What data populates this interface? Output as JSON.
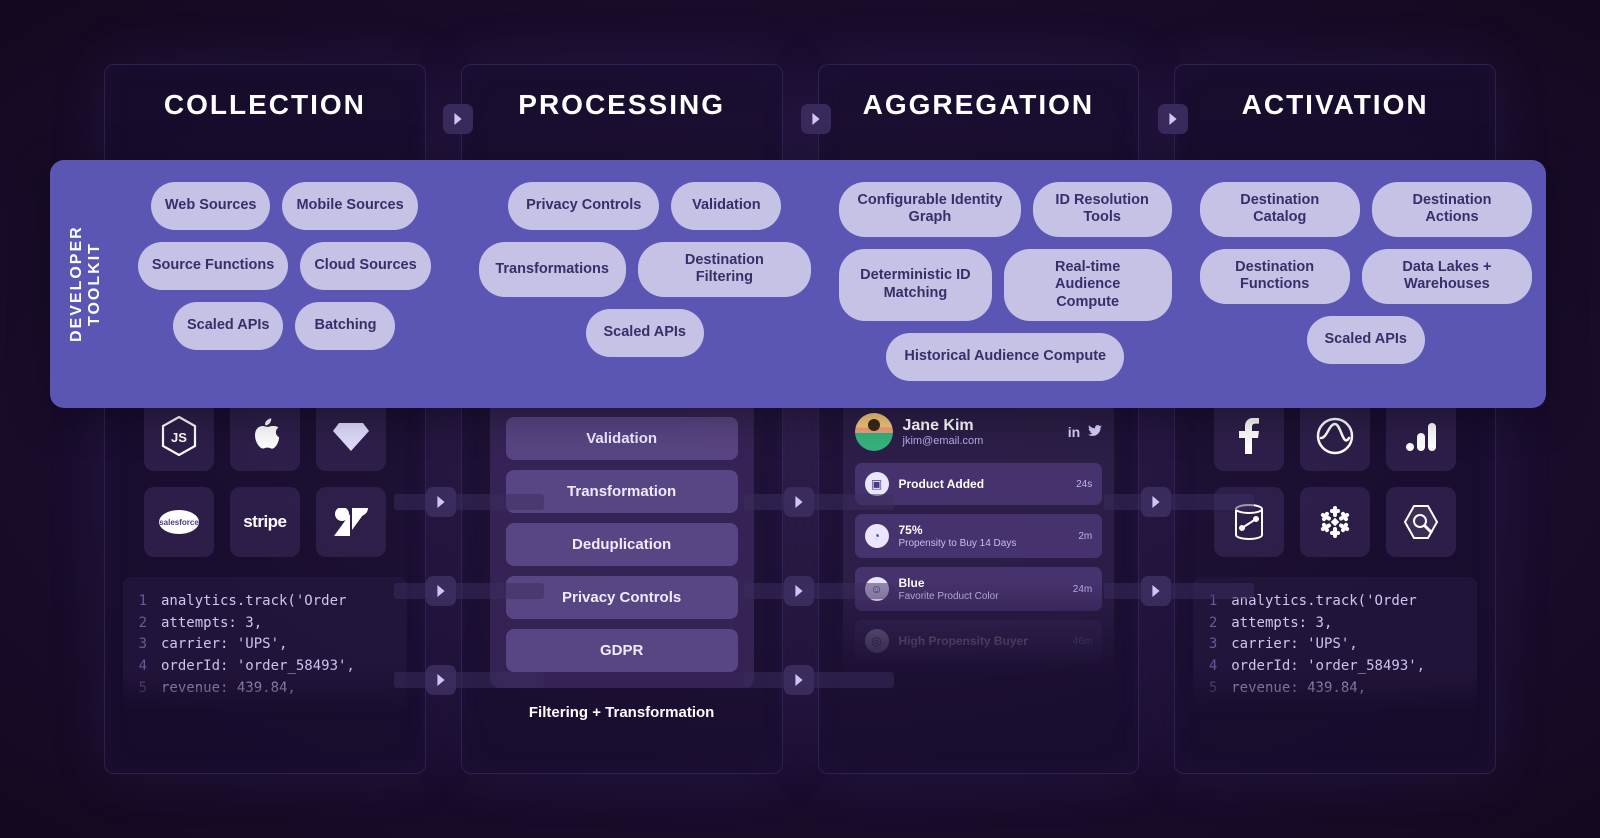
{
  "toolkit_label": "DEVELOPER TOOLKIT",
  "columns": [
    {
      "title": "COLLECTION"
    },
    {
      "title": "PROCESSING"
    },
    {
      "title": "AGGREGATION"
    },
    {
      "title": "ACTIVATION"
    }
  ],
  "toolkit": {
    "collection": [
      [
        "Web Sources",
        "Mobile Sources"
      ],
      [
        "Source Functions",
        "Cloud Sources"
      ],
      [
        "Scaled APIs",
        "Batching"
      ]
    ],
    "processing": [
      [
        "Privacy Controls",
        "Validation"
      ],
      [
        "Transformations",
        "Destination Filtering"
      ],
      [
        "Scaled APIs"
      ]
    ],
    "aggregation": [
      [
        "Configurable Identity Graph",
        "ID Resolution Tools"
      ],
      [
        "Deterministic ID Matching",
        "Real-time Audience Compute"
      ],
      [
        "Historical Audience Compute"
      ]
    ],
    "activation": [
      [
        "Destination Catalog",
        "Destination Actions"
      ],
      [
        "Destination Functions",
        "Data Lakes + Warehouses"
      ],
      [
        "Scaled APIs"
      ]
    ]
  },
  "collection_icons": [
    "nodejs",
    "apple",
    "diamond",
    "salesforce",
    "stripe",
    "zendesk"
  ],
  "activation_icons": [
    "facebook",
    "amplitude",
    "analytics",
    "database",
    "snowflake",
    "bigquery"
  ],
  "processing_items": [
    "Validation",
    "Transformation",
    "Deduplication",
    "Privacy Controls",
    "GDPR"
  ],
  "processing_caption": "Filtering + Transformation",
  "profile": {
    "name": "Jane Kim",
    "email": "jkim@email.com",
    "events": [
      {
        "icon": "briefcase",
        "title": "Product Added",
        "sub": "",
        "time": "24s"
      },
      {
        "icon": "gauge",
        "title": "75%",
        "sub": "Propensity to Buy 14 Days",
        "time": "2m"
      },
      {
        "icon": "user",
        "title": "Blue",
        "sub": "Favorite Product Color",
        "time": "24m"
      },
      {
        "icon": "target",
        "title": "High Propensity Buyer",
        "sub": "",
        "time": "46m",
        "faded": true
      }
    ]
  },
  "code": [
    "analytics.track('Order",
    "attempts: 3,",
    "carrier: 'UPS',",
    "orderId: 'order_58493',",
    "revenue: 439.84,"
  ]
}
